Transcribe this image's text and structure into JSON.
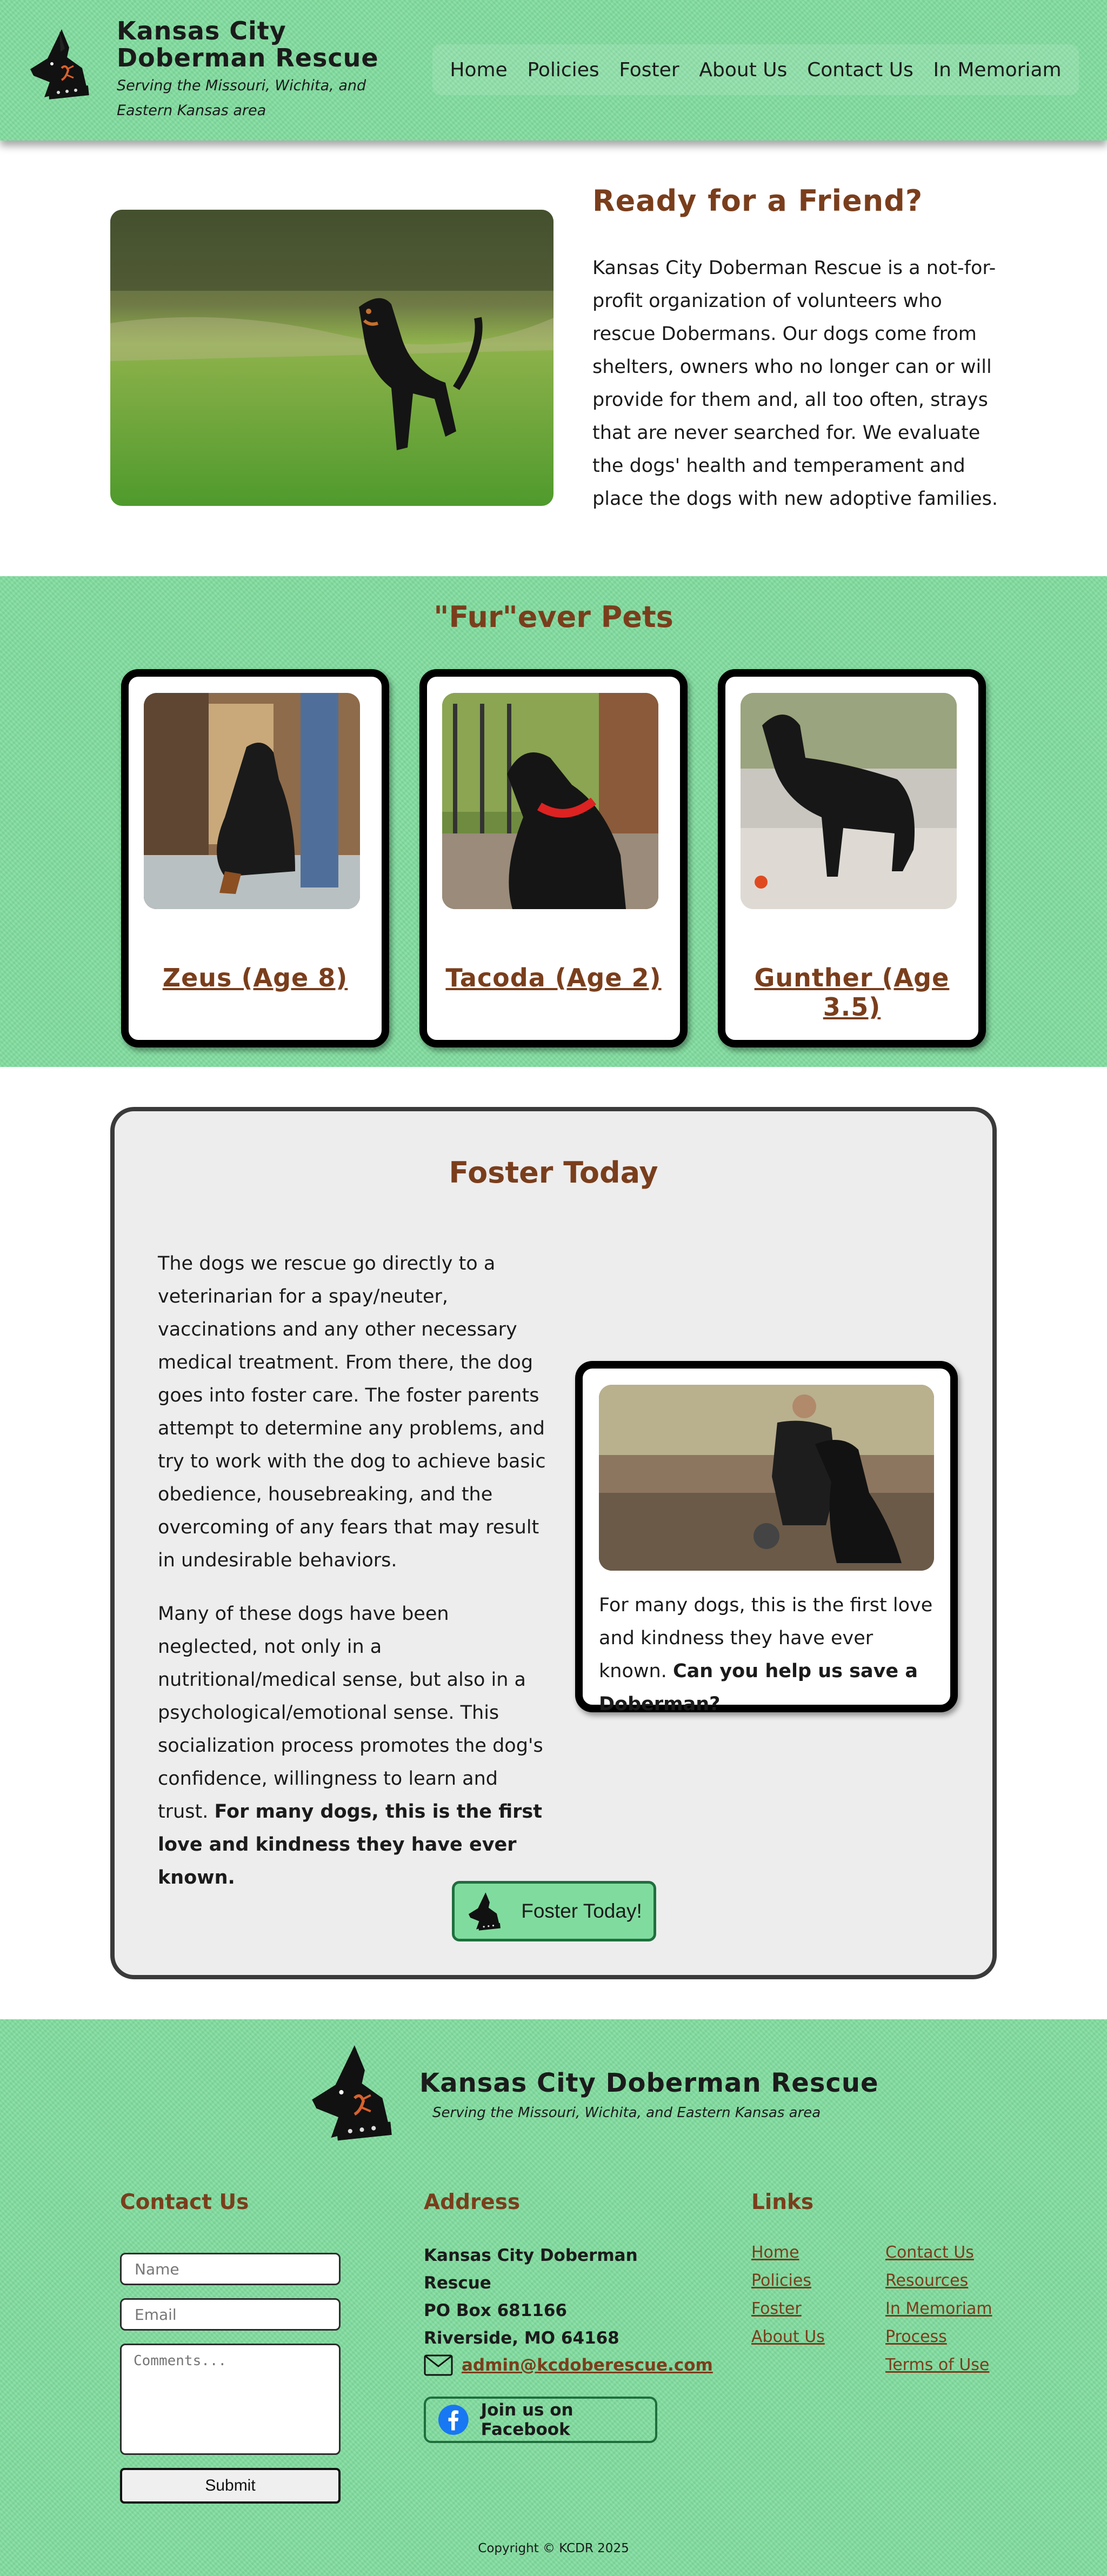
{
  "colors": {
    "brand_green": "#80dc9e",
    "heading_brown": "#7a3e1c",
    "foster_panel": "#ededed",
    "logo_orange": "#d9622b"
  },
  "header": {
    "logo_icon": "doberman-head-logo",
    "title": "Kansas City Doberman Rescue",
    "tagline": "Serving the Missouri, Wichita, and Eastern Kansas area",
    "nav": [
      "Home",
      "Policies",
      "Foster",
      "About Us",
      "Contact Us",
      "In Memoriam"
    ]
  },
  "intro": {
    "photo_icon": "doberman-running-photo",
    "title": "Ready for a Friend?",
    "text": "Kansas City Doberman Rescue is a not-for-profit organization of volunteers who rescue Dobermans. Our dogs come from shelters, owners who no longer can or will provide for them and, all too often, strays that are never searched for. We evaluate the dogs' health and temperament and place the dogs with new adoptive families."
  },
  "pets": {
    "title": "\"Fur\"ever Pets",
    "items": [
      {
        "name": "Zeus (Age 8)",
        "photo_icon": "doberman-sitting-photo"
      },
      {
        "name": "Tacoda (Age 2)",
        "photo_icon": "doberman-red-collar-photo"
      },
      {
        "name": "Gunther (Age 3.5)",
        "photo_icon": "doberman-standing-photo"
      }
    ]
  },
  "foster": {
    "title": "Foster Today",
    "p1": "The dogs we rescue go directly to a veterinarian for a spay/neuter, vaccinations and any other necessary medical treatment. From there, the dog goes into foster care. The foster parents attempt to determine any problems, and try to work with the dog to achieve basic obedience, housebreaking, and the overcoming of any fears that may result in undesirable behaviors.",
    "p2_plain": "Many of these dogs have been neglected, not only in a nutritional/medical sense, but also in a psychological/emotional sense. This socialization process promotes the dog's confidence, willingness to learn and trust.",
    "p2_bold": "For many dogs, this is the first love and kindness they have ever known.",
    "card_photo_icon": "man-with-doberman-photo",
    "card_text": "For many dogs, this is the first love and kindness they have ever known.",
    "card_bold": "Can you help us save a Doberman?",
    "button_label": "Foster Today!"
  },
  "footer": {
    "title": "Kansas City Doberman Rescue",
    "tagline": "Serving the Missouri, Wichita, and Eastern Kansas area",
    "contact": {
      "heading": "Contact Us",
      "name_placeholder": "Name",
      "email_placeholder": "Email",
      "comments_placeholder": "Comments...",
      "submit_label": "Submit"
    },
    "address": {
      "heading": "Address",
      "line1": "Kansas City Doberman Rescue",
      "line2": "PO Box 681166",
      "line3": "Riverside, MO 64168",
      "email": "admin@kcdoberescue.com",
      "facebook_label": "Join us on Facebook"
    },
    "links": {
      "heading": "Links",
      "col1": [
        "Home",
        "Policies",
        "Foster",
        "About Us"
      ],
      "col2": [
        "Contact Us",
        "Resources",
        "In Memoriam",
        "Process",
        "Terms of Use"
      ]
    },
    "copyright": "Copyright © KCDR 2025"
  }
}
